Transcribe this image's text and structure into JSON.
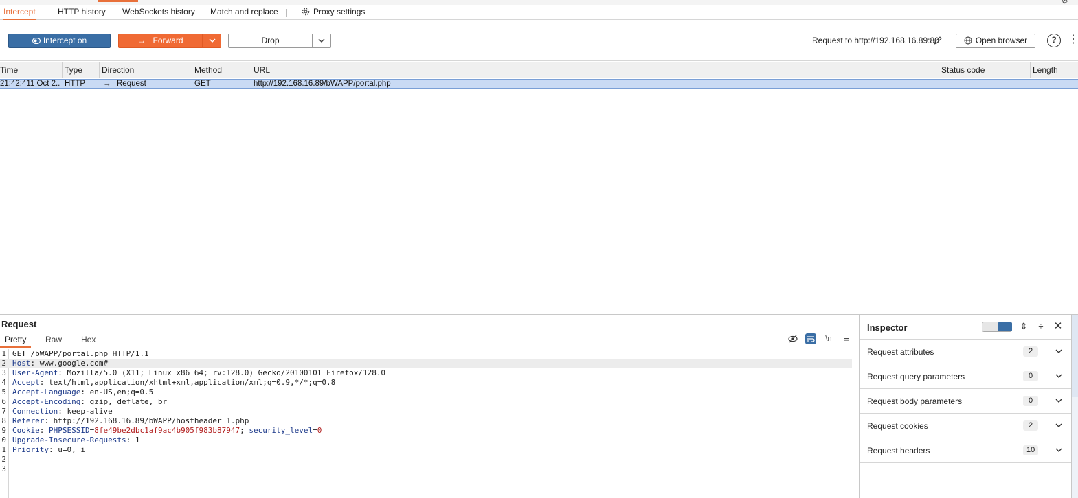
{
  "subtabs": {
    "intercept": "Intercept",
    "http_history": "HTTP history",
    "websockets_history": "WebSockets history",
    "match_replace": "Match and replace",
    "proxy_settings": "Proxy settings"
  },
  "toolbar": {
    "intercept_label": "Intercept on",
    "forward_label": "Forward",
    "drop_label": "Drop",
    "request_target": "Request to http://192.168.16.89:80",
    "open_browser_label": "Open browser",
    "help_glyph": "?"
  },
  "colors": {
    "accent": "#e8703a",
    "intercept_blue": "#3a6ea5",
    "forward_orange": "#f06a34",
    "selected_row": "#c9daf4"
  },
  "table": {
    "headers": {
      "time": "Time",
      "type": "Type",
      "direction": "Direction",
      "method": "Method",
      "url": "URL",
      "status": "Status code",
      "length": "Length"
    },
    "rows": [
      {
        "time": "21:42:411 Oct 2...",
        "type": "HTTP",
        "direction": "Request",
        "method": "GET",
        "url": "http://192.168.16.89/bWAPP/portal.php",
        "status": "",
        "length": ""
      }
    ]
  },
  "request": {
    "title": "Request",
    "tabs": {
      "pretty": "Pretty",
      "raw": "Raw",
      "hex": "Hex"
    },
    "newline_toggle": "\\n",
    "line_numbers": [
      "1",
      "2",
      "3",
      "4",
      "5",
      "6",
      "7",
      "8",
      "9",
      "0",
      "1",
      "2",
      "3"
    ],
    "lines": {
      "l1": "GET /bWAPP/portal.php HTTP/1.1",
      "l2k": "Host",
      "l2v": ": www.google.com#",
      "l3k": "User-Agent",
      "l3v": ": Mozilla/5.0 (X11; Linux x86_64; rv:128.0) Gecko/20100101 Firefox/128.0",
      "l4k": "Accept",
      "l4v": ": text/html,application/xhtml+xml,application/xml;q=0.9,*/*;q=0.8",
      "l5k": "Accept-Language",
      "l5v": ": en-US,en;q=0.5",
      "l6k": "Accept-Encoding",
      "l6v": ": gzip, deflate, br",
      "l7k": "Connection",
      "l7v": ": keep-alive",
      "l8k": "Referer",
      "l8v": ": http://192.168.16.89/bWAPP/hostheader_1.php",
      "l9k": "Cookie",
      "l9sep": ": ",
      "l9c1k": "PHPSESSID",
      "l9eq1": "=",
      "l9c1v": "8fe49be2dbc1af9ac4b905f983b87947",
      "l9semi": "; ",
      "l9c2k": "security_level",
      "l9eq2": "=",
      "l9c2v": "0",
      "l10k": "Upgrade-Insecure-Requests",
      "l10v": ": 1",
      "l11k": "Priority",
      "l11v": ": u=0, i"
    }
  },
  "inspector": {
    "title": "Inspector",
    "sections": [
      {
        "label": "Request attributes",
        "count": "2"
      },
      {
        "label": "Request query parameters",
        "count": "0"
      },
      {
        "label": "Request body parameters",
        "count": "0"
      },
      {
        "label": "Request cookies",
        "count": "2"
      },
      {
        "label": "Request headers",
        "count": "10"
      }
    ]
  }
}
